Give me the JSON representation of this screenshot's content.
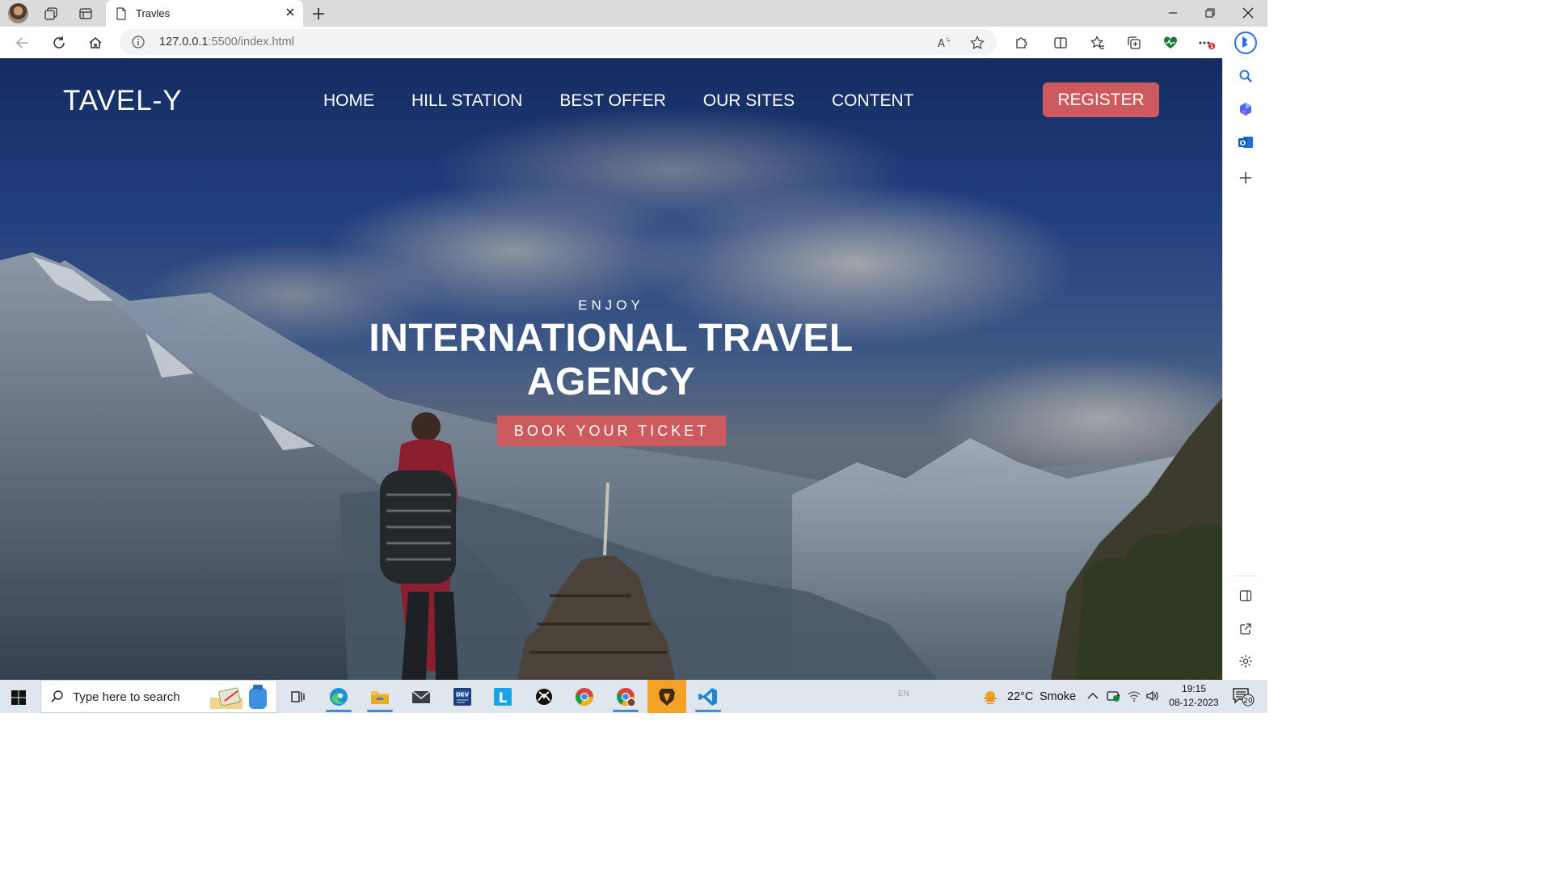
{
  "browser": {
    "tab_title": "Travles",
    "url_host": "127.0.0.1",
    "url_rest": ":5500/index.html",
    "notification_badge": "1"
  },
  "site": {
    "logo": "TAVEL-Y",
    "nav": [
      "HOME",
      "HILL STATION",
      "BEST OFFER",
      "OUR SITES",
      "CONTENT"
    ],
    "register_label": "REGISTER",
    "hero_eyebrow": "ENJOY",
    "hero_title_line1": "INTERNATIONAL TRAVEL",
    "hero_title_line2": "AGENCY",
    "cta_label": "BOOK YOUR TICKET",
    "accent_color": "#cc5a5e"
  },
  "taskbar": {
    "search_placeholder": "Type here to search",
    "weather_temp": "22°C",
    "weather_desc": "Smoke",
    "language": "EN",
    "time": "19:15",
    "date": "08-12-2023",
    "notification_count": "20",
    "apps": [
      "edge-icon",
      "file-explorer-icon",
      "mail-icon",
      "dev-icon",
      "l-app-icon",
      "xbox-icon",
      "chrome-icon",
      "chrome-profile-icon",
      "brave-icon",
      "vscode-icon"
    ]
  }
}
